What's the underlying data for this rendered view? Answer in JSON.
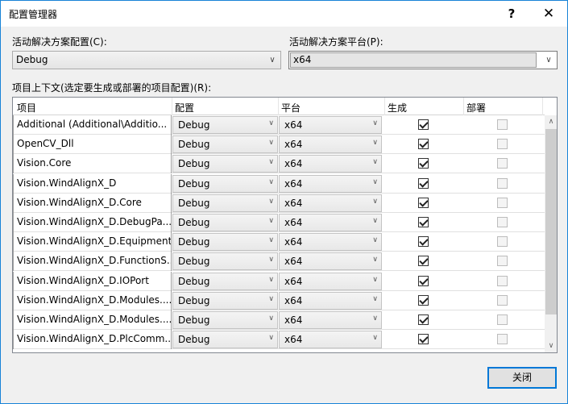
{
  "window": {
    "title": "配置管理器",
    "help_glyph": "?",
    "close_glyph": "✕"
  },
  "active_config": {
    "label": "活动解决方案配置(C):",
    "value": "Debug"
  },
  "active_platform": {
    "label": "活动解决方案平台(P):",
    "value": "x64"
  },
  "project_contexts_label": "项目上下文(选定要生成或部署的项目配置)(R):",
  "table": {
    "headers": [
      "项目",
      "配置",
      "平台",
      "生成",
      "部署"
    ],
    "rows": [
      {
        "project": "Additional (Additional\\Additio...",
        "config": "Debug",
        "platform": "x64",
        "build": true,
        "deploy": false
      },
      {
        "project": "OpenCV_Dll",
        "config": "Debug",
        "platform": "x64",
        "build": true,
        "deploy": false
      },
      {
        "project": "Vision.Core",
        "config": "Debug",
        "platform": "x64",
        "build": true,
        "deploy": false
      },
      {
        "project": "Vision.WindAlignX_D",
        "config": "Debug",
        "platform": "x64",
        "build": true,
        "deploy": false
      },
      {
        "project": "Vision.WindAlignX_D.Core",
        "config": "Debug",
        "platform": "x64",
        "build": true,
        "deploy": false
      },
      {
        "project": "Vision.WindAlignX_D.DebugPa...",
        "config": "Debug",
        "platform": "x64",
        "build": true,
        "deploy": false
      },
      {
        "project": "Vision.WindAlignX_D.Equipment",
        "config": "Debug",
        "platform": "x64",
        "build": true,
        "deploy": false
      },
      {
        "project": "Vision.WindAlignX_D.FunctionS...",
        "config": "Debug",
        "platform": "x64",
        "build": true,
        "deploy": false
      },
      {
        "project": "Vision.WindAlignX_D.IOPort",
        "config": "Debug",
        "platform": "x64",
        "build": true,
        "deploy": false
      },
      {
        "project": "Vision.WindAlignX_D.Modules....",
        "config": "Debug",
        "platform": "x64",
        "build": true,
        "deploy": false
      },
      {
        "project": "Vision.WindAlignX_D.Modules....",
        "config": "Debug",
        "platform": "x64",
        "build": true,
        "deploy": false
      },
      {
        "project": "Vision.WindAlignX_D.PlcComm...",
        "config": "Debug",
        "platform": "x64",
        "build": true,
        "deploy": false
      }
    ]
  },
  "close_button": "关闭",
  "icons": {
    "combo_arrow": "chevron-down-icon",
    "scroll_up": "chevron-up-icon",
    "scroll_down": "chevron-down-icon"
  }
}
